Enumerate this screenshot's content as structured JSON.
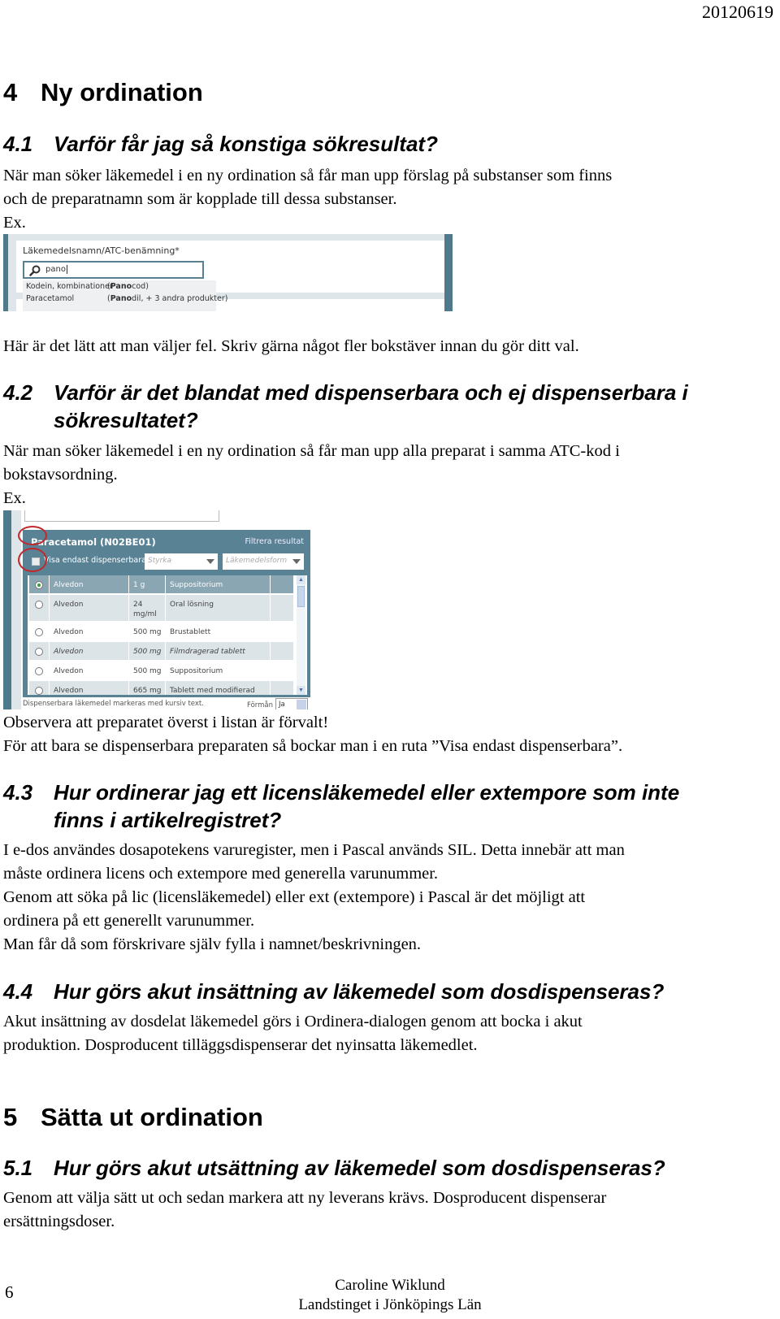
{
  "header": {
    "date": "20120619"
  },
  "sections": {
    "s4": {
      "num": "4",
      "title": "Ny ordination"
    },
    "s4_1": {
      "num": "4.1",
      "title": "Varför får jag så konstiga sökresultat?",
      "lines": [
        "När man söker läkemedel i en ny ordination så får man upp förslag på substanser som finns",
        "och de preparatnamn som är kopplade till dessa substanser.",
        "Ex."
      ],
      "after": "Här är det lätt att man väljer fel. Skriv gärna något fler bokstäver innan du gör ditt val."
    },
    "s4_2": {
      "num": "4.2",
      "title_line1": "Varför är det blandat med dispenserbara och ej dispenserbara i",
      "title_line2": "sökresultatet?",
      "lines": [
        "När man söker läkemedel i en ny ordination så får man upp alla preparat i samma ATC-kod i",
        "bokstavsordning.",
        "Ex."
      ],
      "after": [
        "Observera att preparatet överst i listan är förvalt!",
        "För att bara se dispenserbara preparaten så bockar man i en ruta ”Visa endast dispenserbara”."
      ]
    },
    "s4_3": {
      "num": "4.3",
      "title_line1": "Hur ordinerar jag ett licensläkemedel eller extempore som inte",
      "title_line2": "finns i artikelregistret?",
      "lines": [
        "I e-dos användes dosapotekens varuregister, men i Pascal används SIL. Detta innebär att man",
        "måste ordinera licens och extempore med generella varunummer.",
        "Genom att söka på lic (licensläkemedel) eller ext (extempore) i Pascal är det möjligt att",
        "ordinera på ett generellt varunummer.",
        "Man får då som förskrivare själv fylla i namnet/beskrivningen."
      ]
    },
    "s4_4": {
      "num": "4.4",
      "title": "Hur görs akut insättning av läkemedel som dosdispenseras?",
      "lines": [
        "Akut insättning av dosdelat läkemedel görs i Ordinera-dialogen genom att bocka i akut",
        "produktion. Dosproducent tilläggsdispenserar det nyinsatta läkemedlet."
      ]
    },
    "s5": {
      "num": "5",
      "title": "Sätta ut ordination"
    },
    "s5_1": {
      "num": "5.1",
      "title": "Hur görs akut utsättning av läkemedel som dosdispenseras?",
      "lines": [
        "Genom att välja sätt ut och sedan markera att ny leverans krävs. Dosproducent dispenserar",
        "ersättningsdoser."
      ]
    }
  },
  "screenshot1": {
    "field_label": "Läkemedelsnamn/ATC-benämning*",
    "search_value": "pano",
    "search_icon": "magnifier-icon",
    "suggestions": [
      {
        "substance": "Kodein, kombinationer",
        "prefix": "Pano",
        "product_rest": "cod",
        "open": "(",
        "close": ")"
      },
      {
        "substance": "Paracetamol",
        "prefix": "Pano",
        "product_rest": "dil, + 3 andra produkter",
        "open": "(",
        "close": ")"
      }
    ]
  },
  "screenshot2": {
    "title": "Paracetamol (N02BE01)",
    "filter_label": "Filtrera resultat",
    "checkbox_label": "Visa endast dispenserbara",
    "checkbox_checked": false,
    "select_strength_placeholder": "Styrka",
    "select_form_placeholder": "Läkemedelsform",
    "rows": [
      {
        "name": "Alvedon",
        "strength": "1 g",
        "form": "Suppositorium",
        "selected": true,
        "italic": false
      },
      {
        "name": "Alvedon",
        "strength": "24 mg/ml",
        "form": "Oral lösning",
        "selected": false,
        "italic": false
      },
      {
        "name": "Alvedon",
        "strength": "500 mg",
        "form": "Brustablett",
        "selected": false,
        "italic": false
      },
      {
        "name": "Alvedon",
        "strength": "500 mg",
        "form": "Filmdragerad tablett",
        "selected": false,
        "italic": true
      },
      {
        "name": "Alvedon",
        "strength": "500 mg",
        "form": "Suppositorium",
        "selected": false,
        "italic": false
      },
      {
        "name": "Alvedon",
        "strength": "665 mg",
        "form": "Tablett med modifierad",
        "selected": false,
        "italic": false
      }
    ],
    "caption": "Dispenserbara läkemedel markeras med kursiv text.",
    "benefit_label": "Förmån",
    "benefit_value": "Ja",
    "highlight_color": "#c0282c",
    "header_color": "#5a8295"
  },
  "footer": {
    "page_number": "6",
    "author": "Caroline Wiklund",
    "organization": "Landstinget i Jönköpings Län"
  }
}
